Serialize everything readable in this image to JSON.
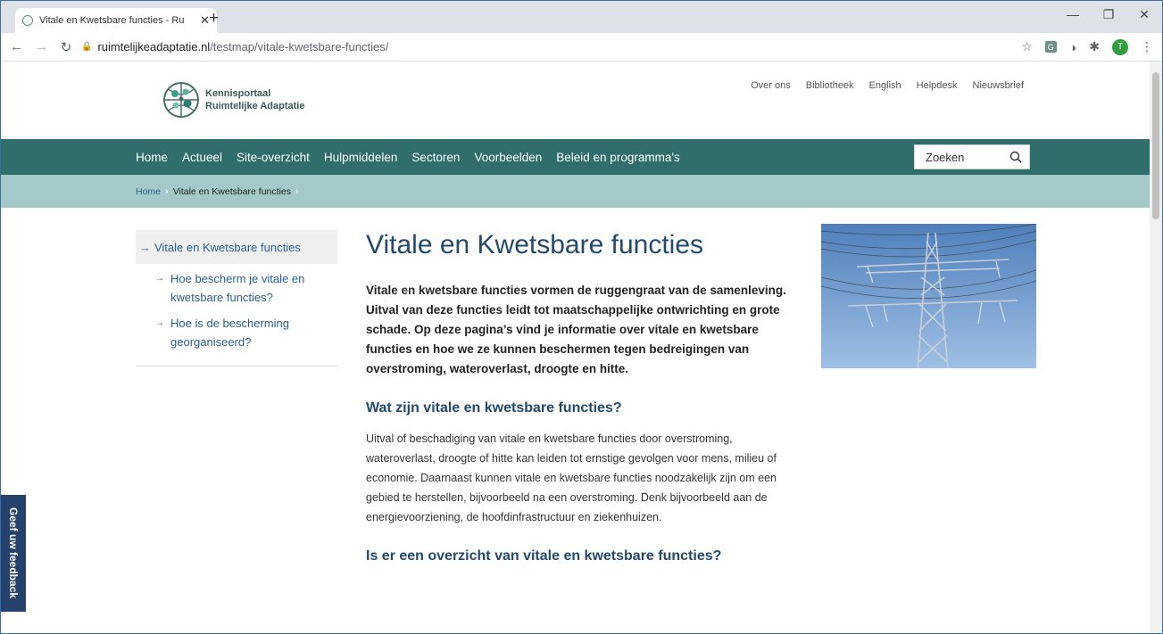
{
  "browser": {
    "tab_title": "Vitale en Kwetsbare functies - Ru",
    "url_host": "ruimtelijkeadaptatie.nl",
    "url_path": "/testmap/vitale-kwetsbare-functies/",
    "avatar_letter": "T",
    "extension_g_label": "G"
  },
  "site": {
    "logo_line1": "Kennisportaal",
    "logo_line2": "Ruimtelijke Adaptatie",
    "top_links": [
      "Over ons",
      "Bibliotheek",
      "English",
      "Helpdesk",
      "Nieuwsbrief"
    ],
    "nav_items": [
      "Home",
      "Actueel",
      "Site-overzicht",
      "Hulpmiddelen",
      "Sectoren",
      "Voorbeelden",
      "Beleid en programma's"
    ],
    "search_placeholder": "Zoeken",
    "breadcrumb_home": "Home",
    "breadcrumb_current": "Vitale en Kwetsbare functies",
    "feedback_label": "Geef uw feedback",
    "colors": {
      "nav_bg": "#2f6e6a",
      "crumb_bg": "#a3c9c8",
      "heading": "#234a6e",
      "link": "#2a5f8f",
      "feedback_bg": "#24426b"
    }
  },
  "subnav": {
    "active": "Vitale en Kwetsbare functies",
    "children": [
      "Hoe bescherm je vitale en kwetsbare functies?",
      "Hoe is de bescherming georganiseerd?"
    ]
  },
  "article": {
    "title": "Vitale en Kwetsbare functies",
    "lead": "Vitale en kwetsbare functies vormen de ruggengraat van de samenleving. Uitval van deze functies leidt tot maatschappelijke ontwrichting en grote schade. Op deze pagina’s vind je informatie over vitale en kwetsbare functies en hoe we ze kunnen beschermen tegen bedreigingen van overstroming, wateroverlast, droogte en hitte.",
    "h2_1": "Wat zijn vitale en kwetsbare functies?",
    "p_1": "Uitval of beschadiging van vitale en kwetsbare functies door overstroming, wateroverlast, droogte of hitte kan leiden tot ernstige gevolgen voor mens, milieu of economie. Daarnaast kunnen vitale en kwetsbare functies noodzakelijk zijn om een gebied te herstellen, bijvoorbeeld na een overstroming. Denk bijvoorbeeld aan de energievoorziening, de hoofdinfrastructuur en ziekenhuizen.",
    "h2_2": "Is er een overzicht van vitale en kwetsbare functies?"
  }
}
